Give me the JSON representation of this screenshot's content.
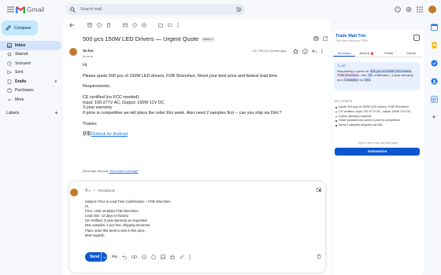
{
  "topbar": {
    "app_name": "Gmail",
    "search_placeholder": "Search mail"
  },
  "nav": {
    "compose_label": "Compose",
    "items": [
      {
        "label": "Inbox",
        "count": "",
        "icon": "inbox-icon"
      },
      {
        "label": "Starred",
        "count": "",
        "icon": "star-icon"
      },
      {
        "label": "Snoozed",
        "count": "",
        "icon": "clock-icon"
      },
      {
        "label": "Sent",
        "count": "",
        "icon": "send-icon"
      },
      {
        "label": "Drafts",
        "count": "2",
        "icon": "draft-icon"
      },
      {
        "label": "Purchases",
        "count": "",
        "icon": "purchases-icon"
      },
      {
        "label": "More",
        "count": "",
        "icon": "chevron-down-icon"
      }
    ],
    "labels_heading": "Labels"
  },
  "email": {
    "subject": "500 pcs 150W LED Drivers — Urgent Quote",
    "folder_chip": "Inbox ×",
    "sender_name": "Su leo",
    "to_line": "to me ▾",
    "time": "1:57 PM (25 minutes ago)",
    "body": [
      "Hi,",
      "Please quote 500 pcs of 150W LED drivers, FOB Shenzhen. Need your best price and fastest lead time.",
      "Requirements:",
      "CE certified (no FCC needed)",
      "Input: 100-277V AC, Output: 150W 12V DC",
      "3-year warranty",
      "If price is competitive we will place the order this week. Also need 2 samples first -- can you ship via DHL?",
      "Thanks"
    ],
    "signature_prefix": "获取",
    "signature_link": "Outlook for Android",
    "clipped_prefix": "[Message clipped]",
    "clipped_link": "View entire message"
  },
  "reply": {
    "header": "Recipients",
    "lines": [
      "Subject: Price & Lead Time Confirmation – FOB Shenzhen",
      "Hi,",
      "Price: USD 18.50/pc FOB Shenzhen.",
      "Lead time: 12 days ex-factory.",
      "CE certified, 3-year warranty as requested.",
      "DHL samples: 2 pcs free, shipping tomorrow.",
      "Place order this week to lock in this price.",
      "Best regards,"
    ],
    "send_label": "Send"
  },
  "panel": {
    "title": "Trade Mail Trio",
    "subtitle": "Turn inbox into your CRM",
    "tabs": [
      {
        "label": "Summary",
        "badge": ""
      },
      {
        "label": "Actions",
        "badge": "3"
      },
      {
        "label": "Polish",
        "badge": ""
      },
      {
        "label": "Clients",
        "badge": ""
      }
    ],
    "tldr_heading": "TL;DR",
    "tldr_parts": {
      "a": "Requesting a quote for",
      "b": "500 pcs of 150W LED drivers",
      "c": ",",
      "d": "FOB Shenzhen",
      "e": ", with",
      "f": "CE",
      "g": "certification, 3-year warranty and",
      "h": "2 samples",
      "i": "via",
      "j": "DHL",
      "k": "."
    },
    "kp_heading": "KEY POINTS",
    "key_points": [
      "Quote 500 pcs of 150W LED drivers, FOB Shenzhen.",
      "CE certified, input 100-277V AC, output 150W 12V DC.",
      "3-year warranty required.",
      "Order possible this week if price is competitive.",
      "Need 2 samples shipped via DHL."
    ],
    "open_note": "Open a new email and click again",
    "summarize_label": "Summarize"
  },
  "colors": {
    "accent": "#0b57d0",
    "compose_bg": "#c2e7ff",
    "nav_active": "#d3e3fd",
    "badge_red": "#d93025"
  }
}
